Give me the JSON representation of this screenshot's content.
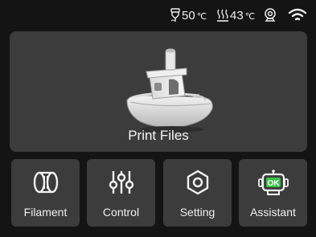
{
  "status_bar": {
    "nozzle_temp": "50",
    "bed_temp": "43",
    "temp_unit": "℃",
    "nozzle_icon": "nozzle-icon",
    "bed_icon": "heated-bed-icon",
    "camera_icon": "camera-icon",
    "wifi_icon": "wifi-icon"
  },
  "main": {
    "print_files_label": "Print Files",
    "preview_icon": "benchy-boat-model"
  },
  "tiles": [
    {
      "label": "Filament",
      "icon": "filament-spool-icon"
    },
    {
      "label": "Control",
      "icon": "sliders-icon"
    },
    {
      "label": "Setting",
      "icon": "hex-nut-settings-icon"
    },
    {
      "label": "Assistant",
      "icon": "assistant-robot-icon"
    }
  ],
  "colors": {
    "background": "#141414",
    "card": "#3c3c3c",
    "text": "#f2f2f2",
    "accent_green": "#39c24a"
  }
}
